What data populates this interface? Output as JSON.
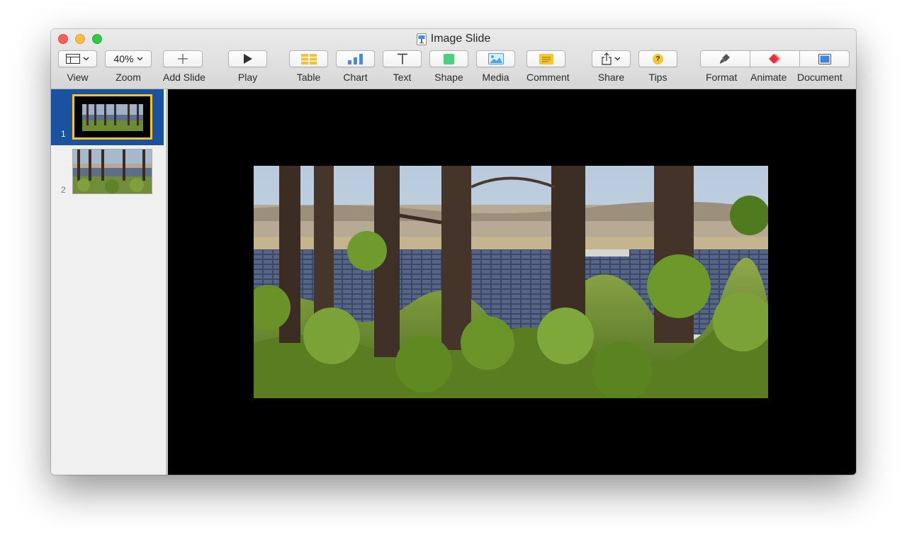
{
  "window": {
    "title": "Image Slide",
    "document_icon": "keynote-document-icon"
  },
  "toolbar": {
    "view_label": "View",
    "zoom_value": "40%",
    "zoom_label": "Zoom",
    "add_slide_label": "Add Slide",
    "play_label": "Play",
    "table_label": "Table",
    "chart_label": "Chart",
    "text_label": "Text",
    "shape_label": "Shape",
    "media_label": "Media",
    "comment_label": "Comment",
    "share_label": "Share",
    "tips_label": "Tips",
    "tips_glyph": "?",
    "format_label": "Format",
    "animate_label": "Animate",
    "document_label": "Document"
  },
  "slides": [
    {
      "number": "1",
      "selected": true
    },
    {
      "number": "2",
      "selected": false
    }
  ],
  "colors": {
    "selection_blue": "#1a52a0",
    "selection_yellow": "#f4c426",
    "canvas_background": "#000000",
    "table_icon": "#f5c12e",
    "chart_icon": "#3b8ef0",
    "shape_icon": "#4cd07a",
    "media_icon": "#4aa3f2",
    "comment_icon": "#f7c62f",
    "animate_icon": "#e8313c",
    "document_icon": "#3d86e0"
  }
}
